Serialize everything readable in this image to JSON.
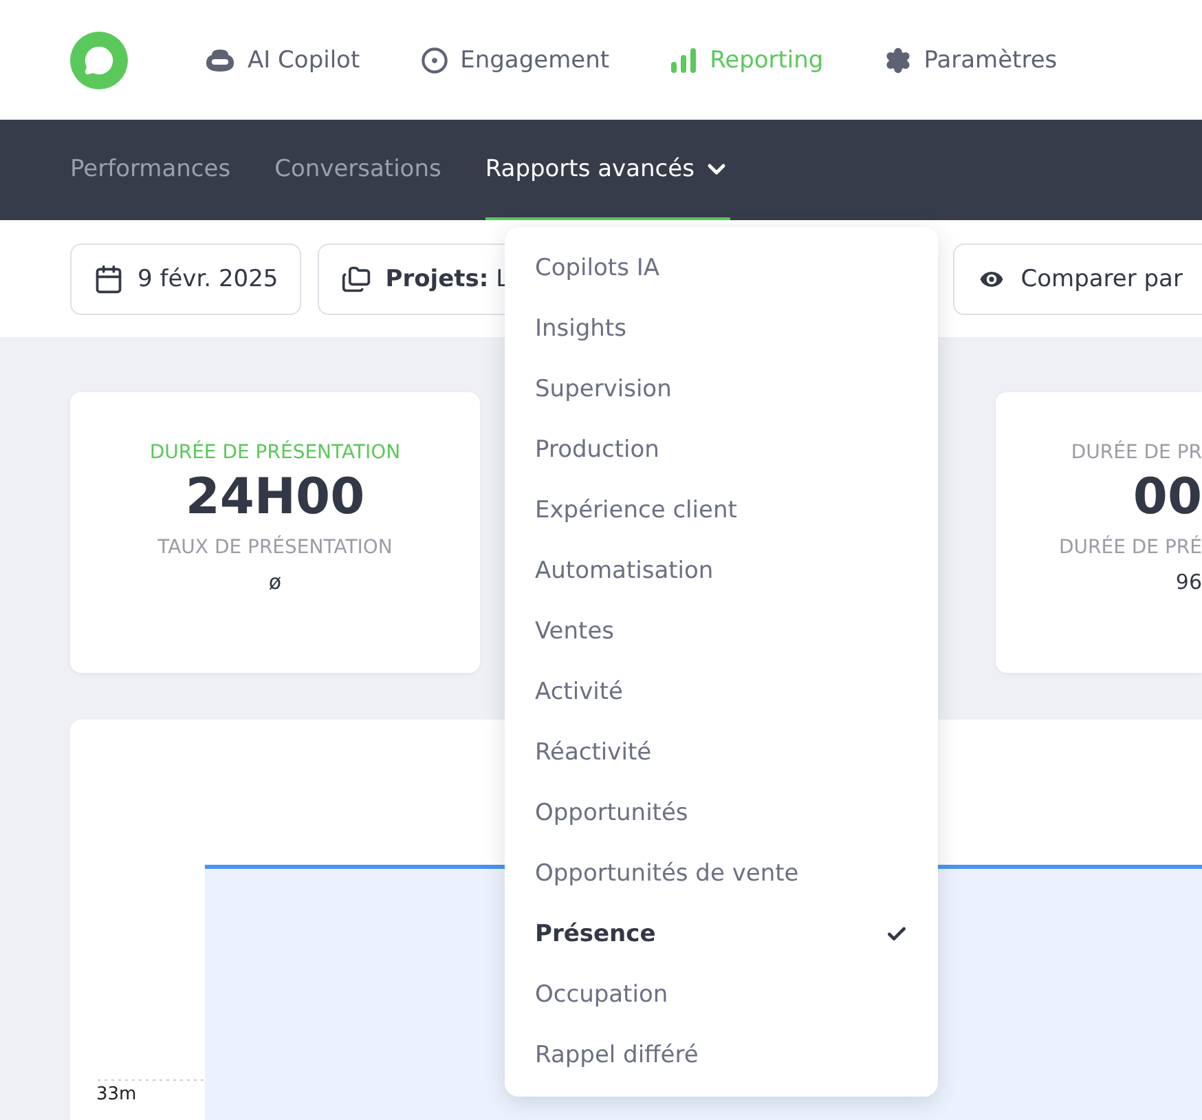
{
  "top_nav": {
    "items": [
      {
        "label": "AI Copilot",
        "selected": false
      },
      {
        "label": "Engagement",
        "selected": false
      },
      {
        "label": "Reporting",
        "selected": true
      },
      {
        "label": "Paramètres",
        "selected": false
      }
    ]
  },
  "sub_nav": {
    "tabs": [
      {
        "label": "Performances",
        "selected": false,
        "has_menu": false
      },
      {
        "label": "Conversations",
        "selected": false,
        "has_menu": false
      },
      {
        "label": "Rapports avancés",
        "selected": true,
        "has_menu": true
      }
    ]
  },
  "filters": {
    "date": "9 févr. 2025",
    "projects_label": "Projets:",
    "projects_value": "L",
    "compare": "Comparer par"
  },
  "cards": [
    {
      "title": "DURÉE DE PRÉSENTATION",
      "highlighted": true,
      "value": "24H00",
      "subtitle": "TAUX DE PRÉSENTATION",
      "subvalue": "ø"
    },
    {
      "title": "DURÉE DE PR",
      "highlighted": false,
      "value": "00",
      "subtitle": "DURÉE DE PRÉ",
      "subvalue": "96"
    }
  ],
  "chart": {
    "y_tick": "33m"
  },
  "menu": {
    "items": [
      {
        "label": "Copilots IA",
        "selected": false
      },
      {
        "label": "Insights",
        "selected": false
      },
      {
        "label": "Supervision",
        "selected": false
      },
      {
        "label": "Production",
        "selected": false
      },
      {
        "label": "Expérience client",
        "selected": false
      },
      {
        "label": "Automatisation",
        "selected": false
      },
      {
        "label": "Ventes",
        "selected": false
      },
      {
        "label": "Activité",
        "selected": false
      },
      {
        "label": "Réactivité",
        "selected": false
      },
      {
        "label": "Opportunités",
        "selected": false
      },
      {
        "label": "Opportunités de vente",
        "selected": false
      },
      {
        "label": "Présence",
        "selected": true
      },
      {
        "label": "Occupation",
        "selected": false
      },
      {
        "label": "Rappel différé",
        "selected": false
      }
    ]
  }
}
